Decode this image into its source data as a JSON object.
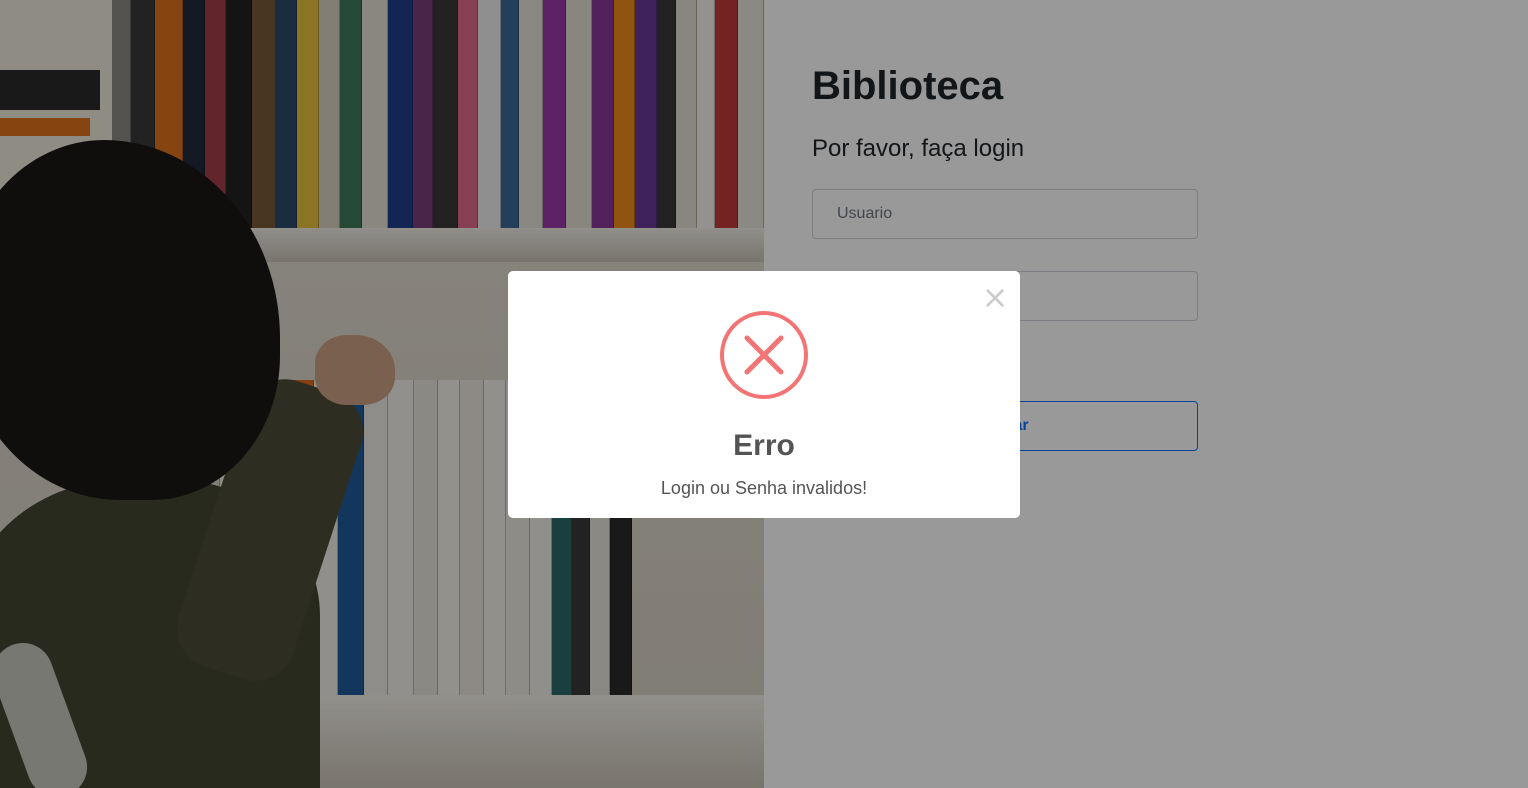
{
  "login": {
    "title": "Biblioteca",
    "subtitle": "Por favor, faça login",
    "username_placeholder": "Usuario",
    "password_placeholder": "",
    "submit_label": "Entrar"
  },
  "modal": {
    "close_symbol": "×",
    "title": "Erro",
    "message": "Login ou Senha invalidos!",
    "icon": "error-x-circle-icon",
    "icon_color": "#f27474"
  },
  "photo": {
    "icon": "bookshelf-photo"
  },
  "colors": {
    "accent": "#0d6efd",
    "error": "#f27474",
    "overlay": "rgba(0,0,0,0.4)"
  }
}
